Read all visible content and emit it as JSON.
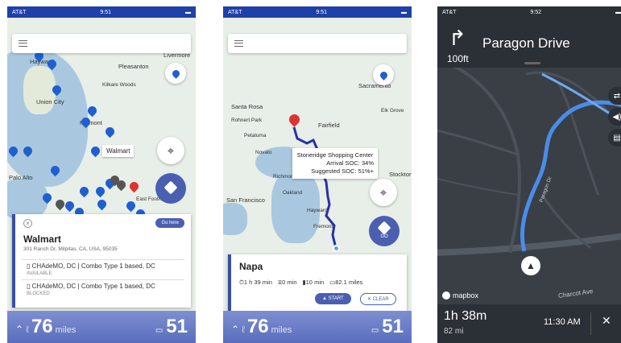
{
  "screen1": {
    "status": {
      "carrier": "AT&T",
      "time": "9:51"
    },
    "map_labels": [
      "Hayward",
      "Pleasanton",
      "Livermore",
      "Kilkare Woods",
      "Union City",
      "Fremont",
      "Palo Alto",
      "East Foothills"
    ],
    "callout": "Walmart",
    "card": {
      "go_here": "Go here",
      "title": "Walmart",
      "address": "301 Ranch Dr, Milpitas, CA, USA, 95035",
      "chargers": [
        {
          "name": "CHAdeMO, DC | Combo Type 1 based, DC",
          "status": "AVAILABLE"
        },
        {
          "name": "CHAdeMO, DC | Combo Type 1 based, DC",
          "status": "BLOCKED"
        }
      ]
    },
    "range": {
      "value": "76",
      "unit": "miles"
    },
    "battery": {
      "value": "51"
    }
  },
  "screen2": {
    "status": {
      "carrier": "AT&T",
      "time": "9:51"
    },
    "map_labels": [
      "Sacramento",
      "Santa Rosa",
      "Rohnert Park",
      "Petaluma",
      "Novato",
      "Fairfield",
      "Elk Grove",
      "Richmond",
      "Oakland",
      "San Francisco",
      "Hayward",
      "Fremont",
      "Stockton"
    ],
    "callout": {
      "title": "Stoneridge Shopping Center",
      "arrival": "Arrival SOC: 34%",
      "suggested": "Suggested SOC: 51%+"
    },
    "go_label": "GO",
    "card": {
      "title": "Napa",
      "duration": "1 h 39 min",
      "wait": "0 min",
      "charge": "10 min",
      "distance": "82.1 miles",
      "start_label": "START",
      "clear_label": "CLEAR"
    },
    "range": {
      "value": "76",
      "unit": "miles"
    },
    "battery": {
      "value": "51"
    }
  },
  "screen3": {
    "status": {
      "carrier": "AT&T",
      "time": "9:52"
    },
    "instruction": {
      "street": "Paragon Drive",
      "distance": "100ft"
    },
    "map_labels": [
      "Charcot Ave",
      "Paragon Dr"
    ],
    "logo": "mapbox",
    "trip": {
      "duration": "1h 38m",
      "distance": "82 mi",
      "eta": "11:30 AM"
    }
  }
}
